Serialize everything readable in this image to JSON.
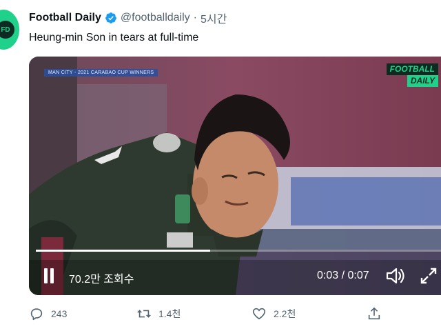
{
  "tweet": {
    "display_name": "Football Daily",
    "handle": "@footballdaily",
    "separator": "·",
    "time_ago": "5시간",
    "text": "Heung-min Son in tears at full-time",
    "verified": true,
    "avatar_initials": "FD"
  },
  "video": {
    "lower_third": "MAN CITY - 2021 CARABAO CUP WINNERS",
    "brand_line1": "FOOTBALL",
    "brand_line2": "DAILY",
    "views": "70.2만 조회수",
    "current_time": "0:03",
    "duration": "0:07",
    "timecode": "0:03 / 0:07",
    "progress_fraction": 0.43,
    "state": "playing"
  },
  "actions": {
    "reply_count": "243",
    "retweet_count": "1.4천",
    "like_count": "2.2천",
    "share_label": ""
  },
  "icons": {
    "verified": "verified-badge-icon",
    "pause": "pause-icon",
    "volume": "volume-icon",
    "fullscreen": "fullscreen-icon",
    "reply": "reply-icon",
    "retweet": "retweet-icon",
    "like": "heart-icon",
    "share": "share-icon"
  },
  "colors": {
    "brand_green": "#1fd18a",
    "verified_blue": "#1d9bf0",
    "secondary_text": "#536471"
  }
}
